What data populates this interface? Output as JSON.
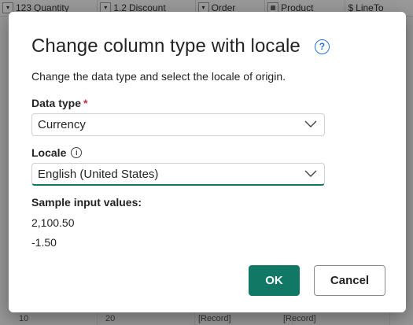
{
  "background": {
    "columns": [
      {
        "type_badge": "123",
        "label": "Quantity"
      },
      {
        "type_badge": "1.2",
        "label": "Discount"
      },
      {
        "type_badge": "",
        "label": "Order"
      },
      {
        "type_badge": "",
        "label": "Product"
      },
      {
        "type_badge": "$",
        "label": "LineTo"
      }
    ],
    "row_cells": [
      "10",
      "20",
      "[Record]",
      "[Record]"
    ]
  },
  "dialog": {
    "title": "Change column type with locale",
    "help_icon": "question-circle-icon",
    "subtitle": "Change the data type and select the locale of origin.",
    "data_type_label": "Data type",
    "required_marker": "*",
    "data_type_value": "Currency",
    "locale_label": "Locale",
    "locale_info_icon": "info-icon",
    "locale_value": "English (United States)",
    "sample_label": "Sample input values:",
    "sample_values": [
      "2,100.50",
      "-1.50"
    ],
    "ok_label": "OK",
    "cancel_label": "Cancel"
  },
  "colors": {
    "accent": "#117865",
    "help_icon": "#2272d6",
    "required": "#c4314b"
  }
}
